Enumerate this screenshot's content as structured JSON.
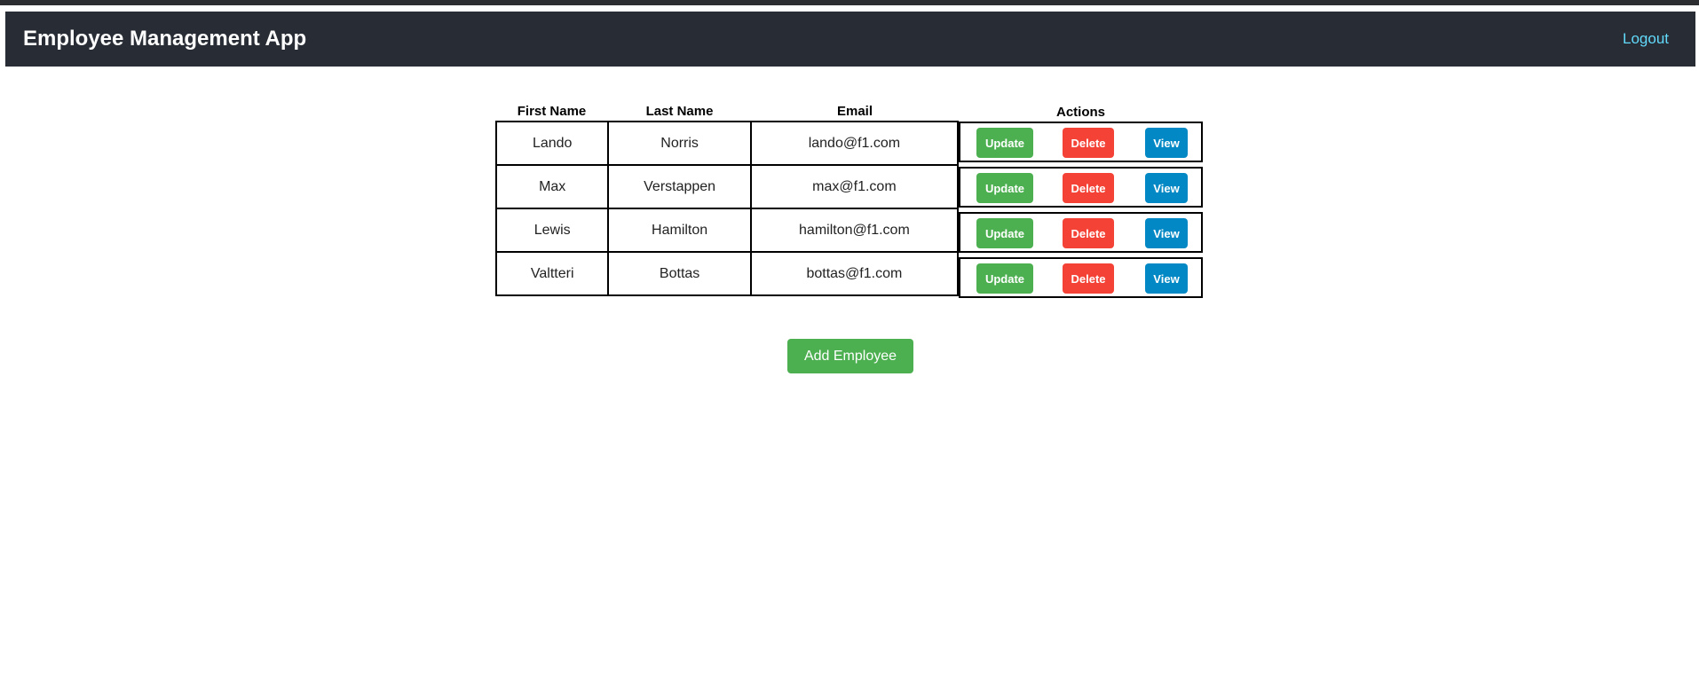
{
  "app": {
    "title": "Employee Management App",
    "logout_label": "Logout"
  },
  "table": {
    "headers": {
      "first_name": "First Name",
      "last_name": "Last Name",
      "email": "Email",
      "actions": "Actions"
    },
    "rows": [
      {
        "first": "Lando",
        "last": "Norris",
        "email": "lando@f1.com"
      },
      {
        "first": "Max",
        "last": "Verstappen",
        "email": "max@f1.com"
      },
      {
        "first": "Lewis",
        "last": "Hamilton",
        "email": "hamilton@f1.com"
      },
      {
        "first": "Valtteri",
        "last": "Bottas",
        "email": "bottas@f1.com"
      }
    ],
    "action_labels": {
      "update": "Update",
      "delete": "Delete",
      "view": "View"
    }
  },
  "add_employee_label": "Add Employee",
  "colors": {
    "navbar": "#282c34",
    "logout": "#61dafb",
    "update": "#4caf50",
    "delete": "#f44336",
    "view": "#0288c4",
    "add": "#4caf50"
  }
}
